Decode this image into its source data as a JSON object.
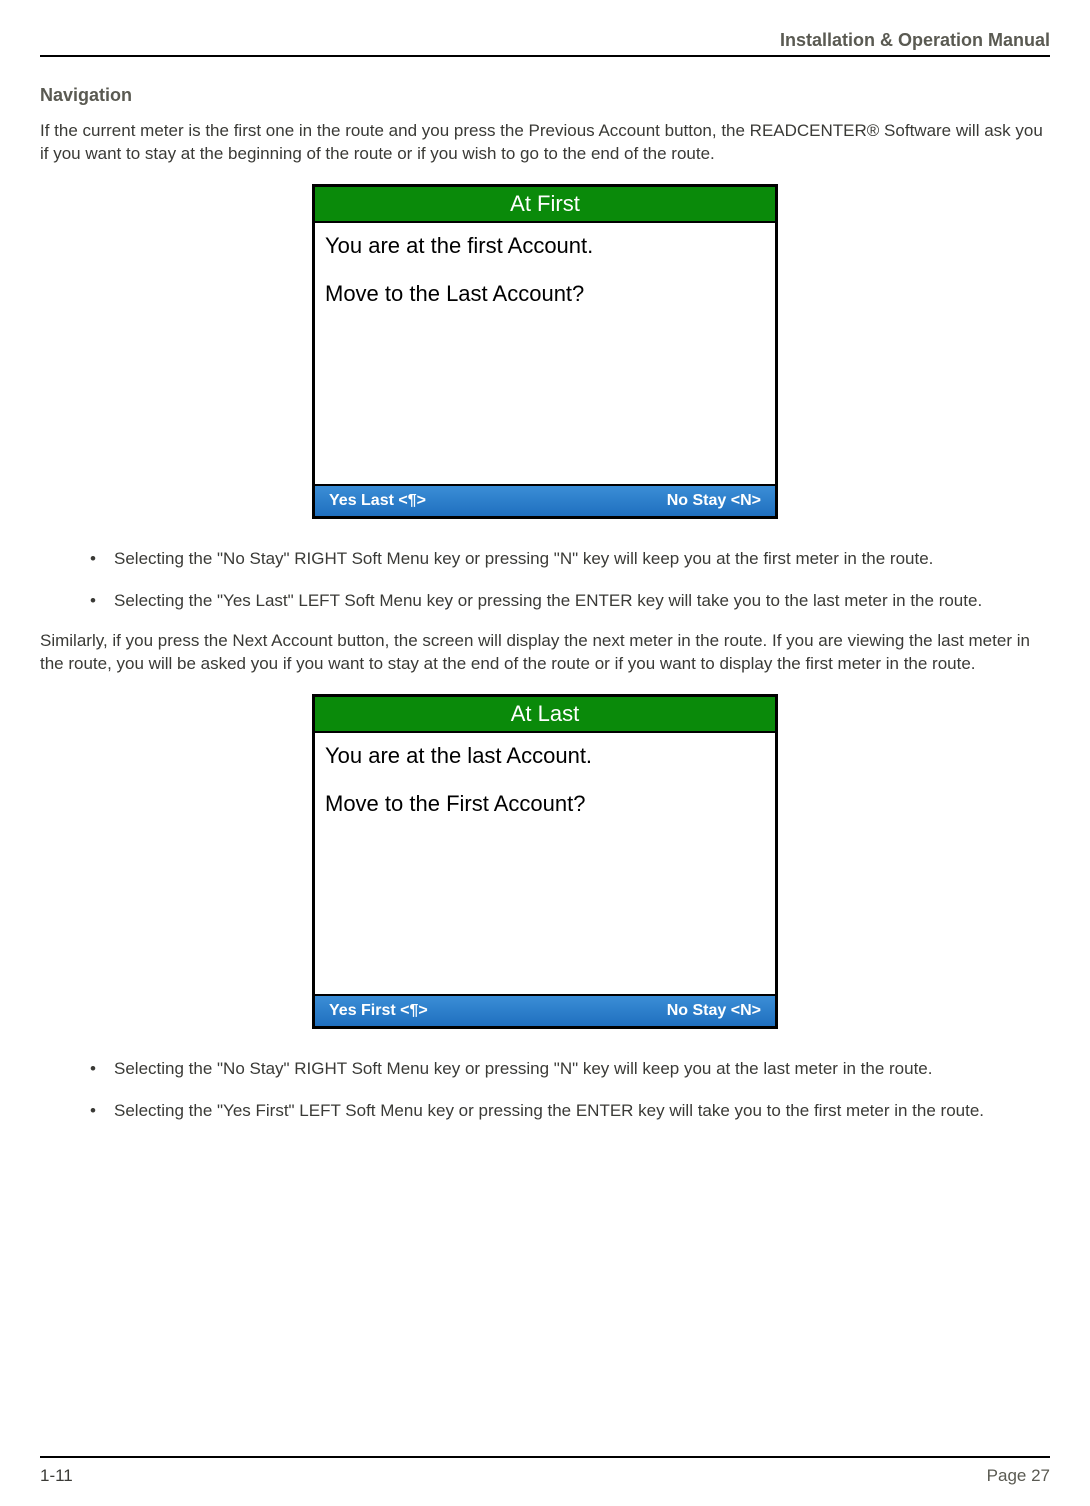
{
  "header": {
    "manual_title": "Installation & Operation Manual"
  },
  "section": {
    "title": "Navigation",
    "intro": "If the current meter is the first one in the route and you press the Previous Account button, the READCENTER® Software will ask you if you want to stay at the beginning of the route or if you wish to go to the end of the route."
  },
  "screenshot1": {
    "title": "At First",
    "line1": "You are at the first Account.",
    "line2": "Move to the Last Account?",
    "soft_left": "Yes Last <¶>",
    "soft_right": "No Stay <N>"
  },
  "bullets1": [
    "Selecting the \"No Stay\" RIGHT Soft Menu key or pressing \"N\" key will keep you at the first meter in the route.",
    "Selecting the \"Yes Last\" LEFT Soft Menu key or pressing the ENTER  key will take you to the last meter in the route."
  ],
  "mid_paragraph": "Similarly, if you press the Next Account button, the screen will display the next meter in the route.  If you are viewing the last meter in the route, you will be asked you if you want to stay at the end of the route or if you want to display the first meter in the route.",
  "screenshot2": {
    "title": "At Last",
    "line1": "You are at the last Account.",
    "line2": "Move to the First Account?",
    "soft_left": "Yes First <¶>",
    "soft_right": "No Stay <N>"
  },
  "bullets2": [
    "Selecting the \"No Stay\" RIGHT Soft Menu key or pressing \"N\" key will keep you at the last meter in the route.",
    "Selecting the \"Yes First\" LEFT Soft Menu key or pressing the ENTER  key will take you to the first meter in the route."
  ],
  "footer": {
    "left": "1-11",
    "right": "Page 27"
  }
}
